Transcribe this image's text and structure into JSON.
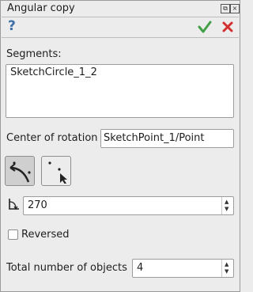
{
  "window": {
    "title": "Angular copy"
  },
  "toolbar": {
    "help_icon": "help-icon",
    "ok_icon": "checkmark-icon",
    "cancel_icon": "close-icon"
  },
  "segments": {
    "label": "Segments:",
    "items": [
      "SketchCircle_1_2"
    ]
  },
  "center": {
    "label": "Center of rotation",
    "value": "SketchPoint_1/Point"
  },
  "mode_buttons": [
    "arc-angle-mode-icon",
    "point-select-mode-icon"
  ],
  "angle": {
    "value": "270"
  },
  "reversed": {
    "label": "Reversed",
    "checked": false
  },
  "total": {
    "label": "Total number of objects",
    "value": "4"
  },
  "colors": {
    "ok": "#43a047",
    "cancel": "#d32f2f",
    "help": "#3c6fa8"
  }
}
